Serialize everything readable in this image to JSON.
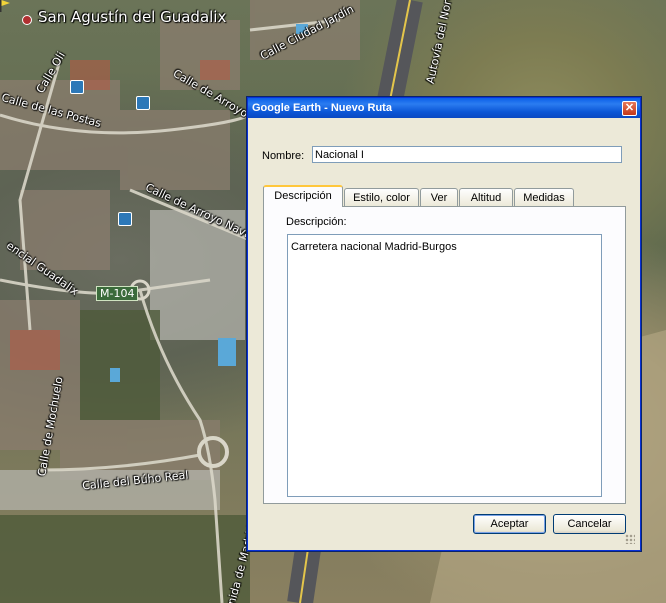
{
  "map": {
    "town_label": "San Agustín del Guadalix",
    "road_shield": "M-104",
    "streets": [
      "Calle Ciudad Jardín",
      "Calle de Arroyo Tejero",
      "Calle de Arroyo Navalaz",
      "Calle de las Postas",
      "Calle del Búho Real",
      "Calle de Mochuelo",
      "Avenida de Madrid",
      "Autovía del Norte",
      "encial Guadalix",
      "Calle Oli"
    ]
  },
  "dialog": {
    "title": "Google Earth - Nuevo Ruta",
    "close_glyph": "✕",
    "name_label": "Nombre:",
    "name_value": "Nacional I",
    "tabs": [
      {
        "label": "Descripción",
        "active": true
      },
      {
        "label": "Estilo, color",
        "active": false
      },
      {
        "label": "Ver",
        "active": false
      },
      {
        "label": "Altitud",
        "active": false
      },
      {
        "label": "Medidas",
        "active": false
      }
    ],
    "description_label": "Descripción:",
    "description_value": "Carretera nacional Madrid-Burgos",
    "ok_label": "Aceptar",
    "cancel_label": "Cancelar"
  },
  "colors": {
    "titlebar": "#0a5ee8",
    "dialog_bg": "#ece9d8",
    "active_tab_accent": "#ffc73c"
  }
}
